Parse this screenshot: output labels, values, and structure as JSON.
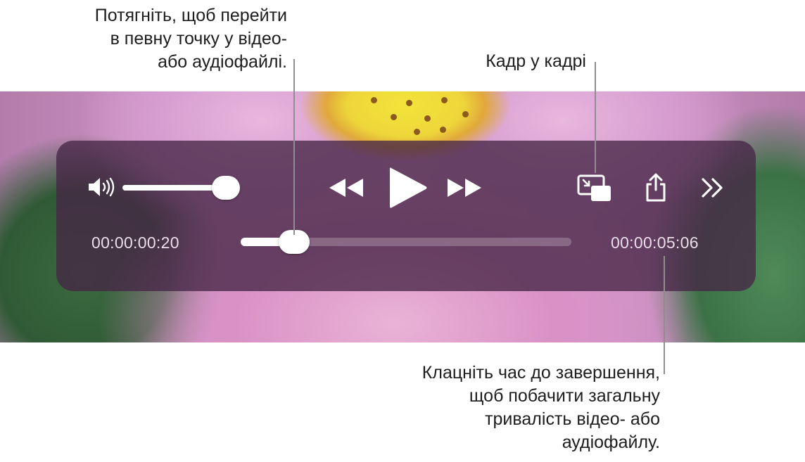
{
  "callouts": {
    "scrub": "Потягніть, щоб перейти\nв певну точку у відео-\nабо аудіофайлі.",
    "pip": "Кадр у кадрі",
    "remaining": "Клацніть час до завершення,\nщоб побачити загальну\nтривалість відео- або\nаудіофайлу."
  },
  "player": {
    "volume_level": 0.9,
    "elapsed_time": "00:00:00:20",
    "remaining_time": "00:00:05:06",
    "progress": 0.16,
    "icons": {
      "volume": "speaker-icon",
      "rewind": "rewind-icon",
      "play": "play-icon",
      "fast_forward": "fast-forward-icon",
      "pip": "picture-in-picture-icon",
      "share": "share-icon",
      "more": "chevron-double-right-icon"
    }
  },
  "colors": {
    "hud_background": "#46264A",
    "control_foreground": "#ffffff",
    "time_text": "#e9dde8"
  }
}
